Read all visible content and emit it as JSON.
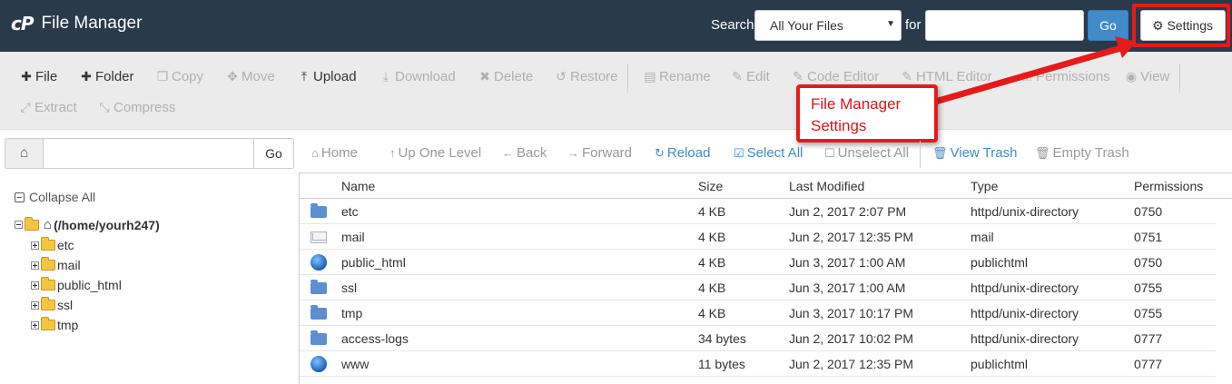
{
  "header": {
    "logo": "cP",
    "title": "File Manager",
    "search_label": "Search",
    "search_scope": "All Your Files",
    "for_label": "for",
    "search_value": "",
    "go_label": "Go",
    "settings_label": "Settings"
  },
  "toolbar": {
    "row1": [
      "File",
      "Folder",
      "Copy",
      "Move",
      "Upload",
      "Download",
      "Delete",
      "Restore",
      "Rename",
      "Edit",
      "Code Editor",
      "HTML Editor",
      "Permissions",
      "View"
    ],
    "row2": [
      "Extract",
      "Compress"
    ]
  },
  "callout": {
    "line1": "File Manager",
    "line2": "Settings"
  },
  "path": {
    "value": "",
    "go_label": "Go"
  },
  "tree": {
    "collapse_label": "Collapse All",
    "root": "(/home/yourh247)",
    "items": [
      "etc",
      "mail",
      "public_html",
      "ssl",
      "tmp"
    ]
  },
  "nav": [
    "Home",
    "Up One Level",
    "Back",
    "Forward",
    "Reload",
    "Select All",
    "Unselect All",
    "View Trash",
    "Empty Trash"
  ],
  "table": {
    "headers": [
      "Name",
      "Size",
      "Last Modified",
      "Type",
      "Permissions"
    ],
    "rows": [
      {
        "name": "etc",
        "size": "4 KB",
        "modified": "Jun 2, 2017 2:07 PM",
        "type": "httpd/unix-directory",
        "perms": "0750",
        "icon": "folder-icon"
      },
      {
        "name": "mail",
        "size": "4 KB",
        "modified": "Jun 2, 2017 12:35 PM",
        "type": "mail",
        "perms": "0751",
        "icon": "mail-icon"
      },
      {
        "name": "public_html",
        "size": "4 KB",
        "modified": "Jun 3, 2017 1:00 AM",
        "type": "publichtml",
        "perms": "0750",
        "icon": "globe-icon"
      },
      {
        "name": "ssl",
        "size": "4 KB",
        "modified": "Jun 3, 2017 1:00 AM",
        "type": "httpd/unix-directory",
        "perms": "0755",
        "icon": "folder-icon"
      },
      {
        "name": "tmp",
        "size": "4 KB",
        "modified": "Jun 3, 2017 10:17 PM",
        "type": "httpd/unix-directory",
        "perms": "0755",
        "icon": "folder-icon"
      },
      {
        "name": "access-logs",
        "size": "34 bytes",
        "modified": "Jun 2, 2017 10:02 PM",
        "type": "httpd/unix-directory",
        "perms": "0777",
        "icon": "folder-icon"
      },
      {
        "name": "www",
        "size": "11 bytes",
        "modified": "Jun 2, 2017 12:35 PM",
        "type": "publichtml",
        "perms": "0777",
        "icon": "globe-icon"
      }
    ]
  },
  "colors": {
    "header_bg": "#293a4a",
    "accent": "#428bca",
    "highlight": "#e51b1b"
  }
}
